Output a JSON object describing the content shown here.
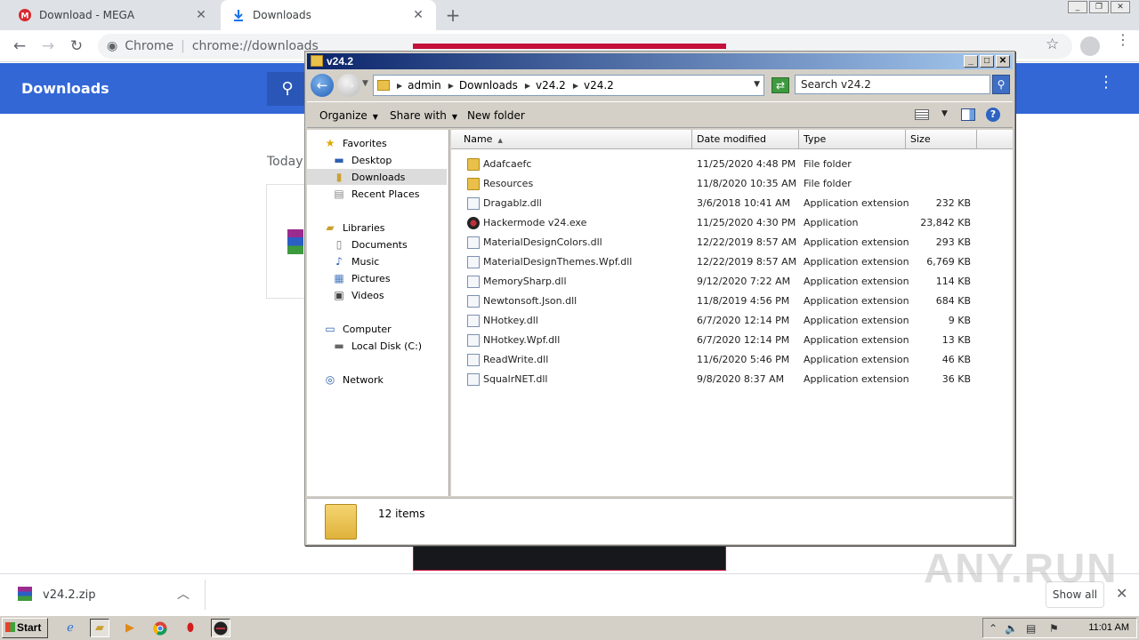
{
  "browser": {
    "tabs": [
      {
        "title": "Download - MEGA"
      },
      {
        "title": "Downloads"
      }
    ],
    "omnibox": {
      "scheme_label": "Chrome",
      "url": "chrome://downloads"
    }
  },
  "downloads_page": {
    "title": "Downloads",
    "section": "Today"
  },
  "shelf": {
    "filename": "v24.2.zip",
    "show_all": "Show all"
  },
  "watermark": "ANY.RUN",
  "explorer": {
    "title": "v24.2",
    "breadcrumb": [
      "admin",
      "Downloads",
      "v24.2",
      "v24.2"
    ],
    "search_placeholder": "Search v24.2",
    "commands": {
      "organize": "Organize",
      "share_with": "Share with",
      "new_folder": "New folder"
    },
    "nav": {
      "favorites": "Favorites",
      "desktop": "Desktop",
      "downloads": "Downloads",
      "recent_places": "Recent Places",
      "libraries": "Libraries",
      "documents": "Documents",
      "music": "Music",
      "pictures": "Pictures",
      "videos": "Videos",
      "computer": "Computer",
      "local_disk": "Local Disk (C:)",
      "network": "Network"
    },
    "columns": {
      "name": "Name",
      "date": "Date modified",
      "type": "Type",
      "size": "Size"
    },
    "files": [
      {
        "name": "Adafcaefc",
        "date": "11/25/2020 4:48 PM",
        "type": "File folder",
        "size": ""
      },
      {
        "name": "Resources",
        "date": "11/8/2020 10:35 AM",
        "type": "File folder",
        "size": ""
      },
      {
        "name": "Dragablz.dll",
        "date": "3/6/2018 10:41 AM",
        "type": "Application extension",
        "size": "232 KB"
      },
      {
        "name": "Hackermode v24.exe",
        "date": "11/25/2020 4:30 PM",
        "type": "Application",
        "size": "23,842 KB"
      },
      {
        "name": "MaterialDesignColors.dll",
        "date": "12/22/2019 8:57 AM",
        "type": "Application extension",
        "size": "293 KB"
      },
      {
        "name": "MaterialDesignThemes.Wpf.dll",
        "date": "12/22/2019 8:57 AM",
        "type": "Application extension",
        "size": "6,769 KB"
      },
      {
        "name": "MemorySharp.dll",
        "date": "9/12/2020 7:22 AM",
        "type": "Application extension",
        "size": "114 KB"
      },
      {
        "name": "Newtonsoft.Json.dll",
        "date": "11/8/2019 4:56 PM",
        "type": "Application extension",
        "size": "684 KB"
      },
      {
        "name": "NHotkey.dll",
        "date": "6/7/2020 12:14 PM",
        "type": "Application extension",
        "size": "9 KB"
      },
      {
        "name": "NHotkey.Wpf.dll",
        "date": "6/7/2020 12:14 PM",
        "type": "Application extension",
        "size": "13 KB"
      },
      {
        "name": "ReadWrite.dll",
        "date": "11/6/2020 5:46 PM",
        "type": "Application extension",
        "size": "46 KB"
      },
      {
        "name": "SqualrNET.dll",
        "date": "9/8/2020 8:37 AM",
        "type": "Application extension",
        "size": "36 KB"
      }
    ],
    "status": "12 items"
  },
  "taskbar": {
    "start": "Start",
    "clock": "11:01 AM"
  }
}
